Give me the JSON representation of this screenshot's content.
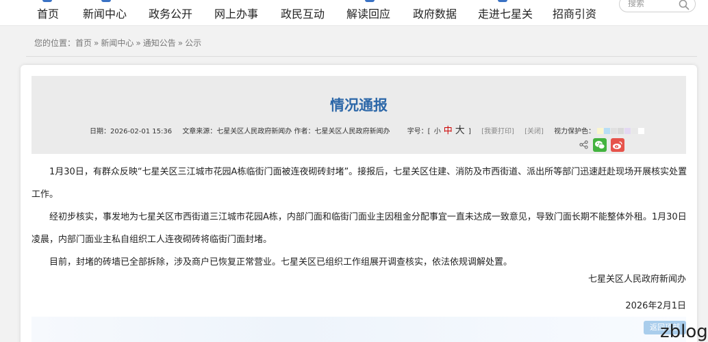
{
  "nav": {
    "items": [
      {
        "label": "首页"
      },
      {
        "label": "新闻中心"
      },
      {
        "label": "政务公开"
      },
      {
        "label": "网上办事"
      },
      {
        "label": "政民互动"
      },
      {
        "label": "解读回应"
      },
      {
        "label": "政府数据"
      },
      {
        "label": "走进七星关"
      },
      {
        "label": "招商引资"
      }
    ],
    "search_placeholder": "搜索",
    "accent": "#3a72c4"
  },
  "breadcrumb": {
    "prefix": "您的位置：",
    "items": [
      "首页",
      "新闻中心",
      "通知公告",
      "公示"
    ],
    "separator": "»"
  },
  "article": {
    "title": "情况通报",
    "date_label": "日期：",
    "date": "2026-02-01 15:36",
    "source_label": "文章来源：",
    "source": "七星关区人民政府新闻办",
    "author_label": "作者：",
    "author": "七星关区人民政府新闻办",
    "font_size_label": "字号：[",
    "font_small": "小",
    "font_mid": "中",
    "font_big": "大",
    "font_close": "]",
    "print_link": "[我要打印]",
    "close_link": "[关闭]",
    "eye_label": "视力保护色：",
    "eye_colors": [
      "#fbf7cf",
      "#b8def5",
      "#e0e0e0",
      "#d9d9d9",
      "#e3d8f2",
      "#e8e8e8",
      "#ffffff"
    ],
    "paragraphs": [
      "1月30日，有群众反映“七星关区三江城市花园A栋临街门面被连夜砌砖封堵”。接报后，七星关区住建、消防及市西街道、派出所等部门迅速赶赴现场开展核实处置工作。",
      "经初步核实，事发地为七星关区市西街道三江城市花园A栋，内部门面和临街门面业主因租金分配事宜一直未达成一致意见，导致门面长期不能整体外租。1月30日凌晨，内部门面业主私自组织工人连夜砌砖将临街门面封堵。",
      "目前，封堵的砖墙已全部拆除，涉及商户已恢复正常营业。七星关区已组织工作组展开调查核实，依法依规调解处置。"
    ],
    "signature": "七星关区人民政府新闻办",
    "sign_date": "2026年2月1日",
    "title_color": "#2c67a8"
  },
  "share": {
    "wechat_color": "#43b33f",
    "weibo_color": "#e6534b"
  },
  "back_button": "返回顶部",
  "watermark": "zblog"
}
